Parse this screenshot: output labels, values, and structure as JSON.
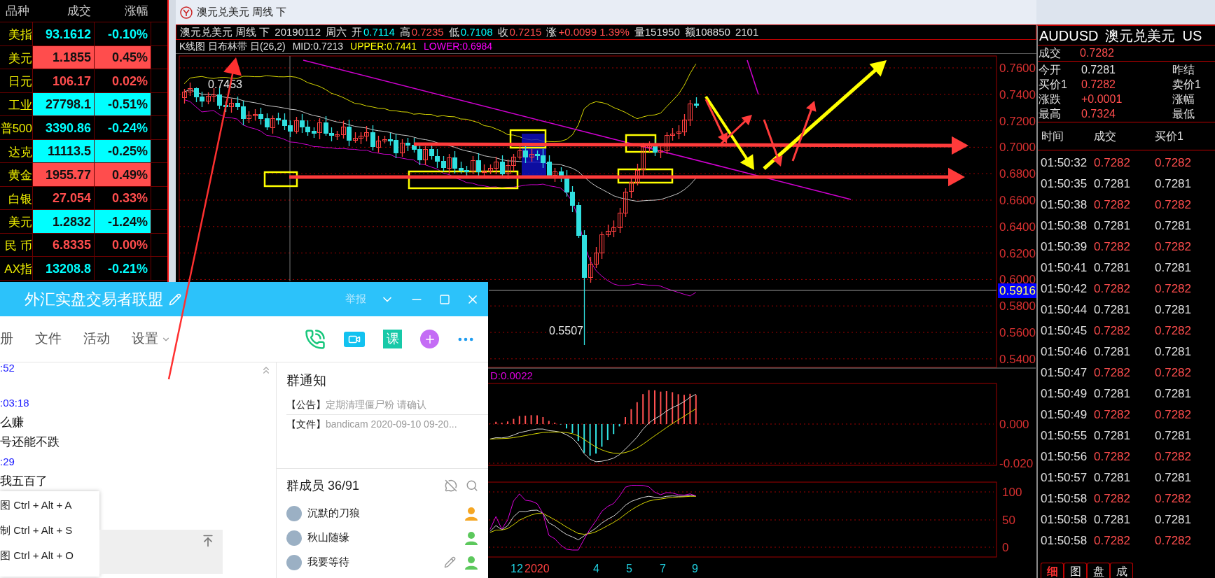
{
  "quote_list": {
    "columns": [
      "品种",
      "成交",
      "涨幅"
    ],
    "rows": [
      {
        "name": "美指",
        "price": "93.1612",
        "change": "-0.10%",
        "rising": false,
        "highlighted": false
      },
      {
        "name": "美元",
        "price": "1.1855",
        "change": "0.45%",
        "rising": true,
        "highlighted": true
      },
      {
        "name": "日元",
        "price": "106.17",
        "change": "0.02%",
        "rising": true,
        "highlighted": false
      },
      {
        "name": "工业",
        "price": "27798.1",
        "change": "-0.51%",
        "rising": false,
        "highlighted": true
      },
      {
        "name": "普500",
        "price": "3390.86",
        "change": "-0.24%",
        "rising": false,
        "highlighted": false
      },
      {
        "name": "达克",
        "price": "11113.5",
        "change": "-0.25%",
        "rising": false,
        "highlighted": true
      },
      {
        "name": "黄金",
        "price": "1955.77",
        "change": "0.49%",
        "rising": true,
        "highlighted": true
      },
      {
        "name": "白银",
        "price": "27.054",
        "change": "0.33%",
        "rising": true,
        "highlighted": false
      },
      {
        "name": "美元",
        "price": "1.2832",
        "change": "-1.24%",
        "rising": false,
        "highlighted": true
      },
      {
        "name": "民 币",
        "price": "6.8335",
        "change": "0.00%",
        "rising": true,
        "highlighted": false
      },
      {
        "name": "AX指",
        "price": "13208.8",
        "change": "-0.21%",
        "rising": false,
        "highlighted": false
      }
    ]
  },
  "chart_window": {
    "title": "澳元兑美元 周线 下",
    "info_line": [
      {
        "label": "澳元兑美元 周线 下"
      },
      {
        "label": "20190112"
      },
      {
        "label": "周六"
      },
      {
        "label": "开",
        "value": "0.7114",
        "rising": false
      },
      {
        "label": "高",
        "value": "0.7235",
        "rising": true
      },
      {
        "label": "低",
        "value": "0.7108",
        "rising": false
      },
      {
        "label": "收",
        "value": "0.7215",
        "rising": true
      },
      {
        "label": "涨",
        "value": "+0.0099 1.39%",
        "rising": true
      },
      {
        "label": "量151950"
      },
      {
        "label": "额108850"
      },
      {
        "label": "2101"
      }
    ],
    "indicator_line": [
      {
        "text": "K线图 日布林带 日(26,2)",
        "kind": "plain"
      },
      {
        "text": "MID:0.7213",
        "kind": "plain"
      },
      {
        "text": "UPPER:0.7441",
        "kind": "upper"
      },
      {
        "text": "LOWER:0.6984",
        "kind": "lower"
      }
    ],
    "price_axis": [
      "0.7600",
      "0.7400",
      "0.7200",
      "0.7000",
      "0.6800",
      "0.6600",
      "0.6400",
      "0.6200",
      "0.6000",
      "0.5800",
      "0.5600",
      "0.5400"
    ],
    "price_marker": "0.5916",
    "high_label": "0.7453",
    "low_label": "0.5507",
    "macd": {
      "label": "D:0.0022",
      "axis": [
        "0.000",
        "-0.020"
      ]
    },
    "kdj": {
      "axis": [
        "100",
        "50",
        "0"
      ]
    },
    "time_axis": [
      {
        "text": "12",
        "kind": "month"
      },
      {
        "text": "2020",
        "kind": "year"
      },
      {
        "text": "4",
        "kind": "month"
      },
      {
        "text": "5",
        "kind": "month"
      },
      {
        "text": "7",
        "kind": "month"
      },
      {
        "text": "9",
        "kind": "month"
      }
    ]
  },
  "quote_panel": {
    "symbol": "AUDUSD",
    "name": "澳元兑美元",
    "extra": "US",
    "last": {
      "label": "成交",
      "value": "0.7282",
      "rising": true
    },
    "stats": [
      {
        "label": "今开",
        "value": "0.7281",
        "rising": false,
        "right_label": "昨结"
      },
      {
        "label": "买价1",
        "value": "0.7282",
        "rising": true,
        "right_label": "卖价1"
      },
      {
        "label": "涨跌",
        "value": "+0.0001",
        "rising": true,
        "right_label": "涨幅"
      },
      {
        "label": "最高",
        "value": "0.7324",
        "rising": true,
        "right_label": "最低"
      }
    ],
    "tick_columns": [
      "时间",
      "成交",
      "买价1"
    ],
    "ticks": [
      {
        "time": "01:50:32",
        "price": "0.7282",
        "bid": "0.7282",
        "rising": true
      },
      {
        "time": "01:50:35",
        "price": "0.7281",
        "bid": "0.7281",
        "rising": false
      },
      {
        "time": "01:50:38",
        "price": "0.7282",
        "bid": "0.7282",
        "rising": true
      },
      {
        "time": "01:50:38",
        "price": "0.7281",
        "bid": "0.7281",
        "rising": false
      },
      {
        "time": "01:50:39",
        "price": "0.7282",
        "bid": "0.7282",
        "rising": true
      },
      {
        "time": "01:50:41",
        "price": "0.7281",
        "bid": "0.7281",
        "rising": false
      },
      {
        "time": "01:50:42",
        "price": "0.7282",
        "bid": "0.7282",
        "rising": true
      },
      {
        "time": "01:50:44",
        "price": "0.7281",
        "bid": "0.7281",
        "rising": false
      },
      {
        "time": "01:50:45",
        "price": "0.7282",
        "bid": "0.7282",
        "rising": true
      },
      {
        "time": "01:50:46",
        "price": "0.7281",
        "bid": "0.7281",
        "rising": false
      },
      {
        "time": "01:50:47",
        "price": "0.7282",
        "bid": "0.7282",
        "rising": true
      },
      {
        "time": "01:50:49",
        "price": "0.7281",
        "bid": "0.7281",
        "rising": false
      },
      {
        "time": "01:50:49",
        "price": "0.7282",
        "bid": "0.7282",
        "rising": true
      },
      {
        "time": "01:50:55",
        "price": "0.7281",
        "bid": "0.7281",
        "rising": false
      },
      {
        "time": "01:50:56",
        "price": "0.7282",
        "bid": "0.7282",
        "rising": true
      },
      {
        "time": "01:50:57",
        "price": "0.7281",
        "bid": "0.7281",
        "rising": false
      },
      {
        "time": "01:50:58",
        "price": "0.7282",
        "bid": "0.7282",
        "rising": true
      },
      {
        "time": "01:50:58",
        "price": "0.7281",
        "bid": "0.7281",
        "rising": false
      },
      {
        "time": "01:50:58",
        "price": "0.7282",
        "bid": "0.7282",
        "rising": true
      }
    ],
    "tabs": [
      {
        "label": "细",
        "selected": true
      },
      {
        "label": "图",
        "selected": false
      },
      {
        "label": "盘",
        "selected": false
      },
      {
        "label": "成",
        "selected": false
      }
    ]
  },
  "chat_window": {
    "title": "外汇实盘交易者联盟",
    "report": "举报",
    "nav": [
      {
        "label": "册",
        "dropdown": false
      },
      {
        "label": "文件",
        "dropdown": false
      },
      {
        "label": "活动",
        "dropdown": false
      },
      {
        "label": "设置",
        "dropdown": true
      }
    ],
    "course_badge": "课",
    "messages": [
      {
        "kind": "time",
        "text": ":52"
      },
      {
        "kind": "time",
        "text": ":03:18"
      },
      {
        "kind": "text",
        "text": "么赚"
      },
      {
        "kind": "text",
        "text": "号还能不跌"
      },
      {
        "kind": "time",
        "text": ":29"
      },
      {
        "kind": "text",
        "text": "我五百了"
      }
    ],
    "context_menu": [
      "图 Ctrl + Alt + A",
      "制 Ctrl + Alt + S",
      "图 Ctrl + Alt + O"
    ],
    "notice": {
      "title": "群通知",
      "items": [
        {
          "tag": "【公告】",
          "text": "定期清理僵尸粉 请确认"
        },
        {
          "tag": "【文件】",
          "text": "bandicam 2020-09-10 09-20..."
        }
      ]
    },
    "members": {
      "title": "群成员 36/91",
      "list": [
        {
          "name": "沉默的刀狼",
          "color": "#f5a623",
          "editable": false
        },
        {
          "name": "秋山随缘",
          "color": "#5cc85c",
          "editable": false
        },
        {
          "name": "我要等待",
          "color": "#5cc85c",
          "editable": true
        }
      ]
    }
  }
}
